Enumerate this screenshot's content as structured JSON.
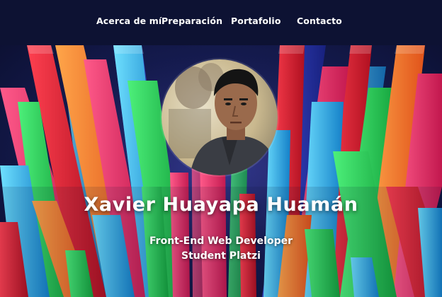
{
  "nav": {
    "items": [
      {
        "label": "Acerca de mí"
      },
      {
        "label": "Preparación"
      },
      {
        "label": "Portafolio"
      },
      {
        "label": "Contacto"
      }
    ]
  },
  "hero": {
    "name": "Xavier Huayapa Huamán",
    "role_line1": "Front-End Web Developer",
    "role_line2": "Student Platzi",
    "avatar_icon": "profile-photo"
  },
  "colors": {
    "navbar": "#0d1233",
    "accent_pink": "#ff3c7a",
    "accent_green": "#2fd35a",
    "accent_cyan": "#37c8ff",
    "accent_orange": "#ff7a2a"
  }
}
